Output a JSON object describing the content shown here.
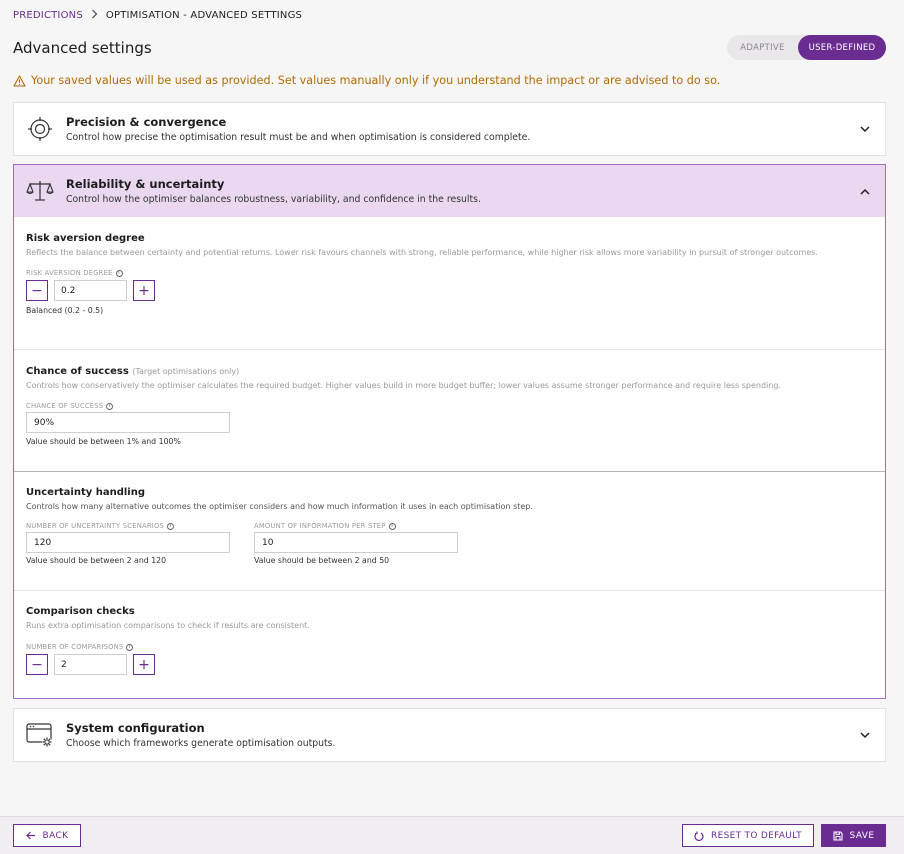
{
  "breadcrumb": {
    "link": "PREDICTIONS",
    "current": "OPTIMISATION - ADVANCED SETTINGS"
  },
  "page_title": "Advanced settings",
  "mode_toggle": {
    "options": [
      "ADAPTIVE",
      "USER-DEFINED"
    ],
    "selected": "USER-DEFINED"
  },
  "warning": "Your saved values will be used as provided. Set values manually only if you understand the impact or are advised to do so.",
  "panels": {
    "precision": {
      "title": "Precision & convergence",
      "desc": "Control how precise the optimisation result must be and when optimisation is considered complete.",
      "expanded": false
    },
    "reliability": {
      "title": "Reliability & uncertainty",
      "desc": "Control how the optimiser balances robustness, variability, and confidence in the results.",
      "expanded": true,
      "sections": {
        "risk": {
          "title": "Risk aversion degree",
          "desc": "Reflects the balance between certainty and potential returns. Lower risk favours channels with strong, reliable performance, while higher risk allows more variability in pursuit of stronger outcomes.",
          "label": "RISK AVERSION DEGREE",
          "value": "0.2",
          "hint": "Balanced (0.2 - 0.5)"
        },
        "chance": {
          "title": "Chance of success",
          "note": "(Target optimisations only)",
          "desc": "Controls how conservatively the optimiser calculates the required budget. Higher values build in more budget buffer; lower values assume stronger performance and require less spending.",
          "label": "CHANCE OF SUCCESS",
          "value": "90%",
          "hint": "Value should be between 1% and 100%"
        },
        "uncertainty": {
          "title": "Uncertainty handling",
          "desc": "Controls how many alternative outcomes the optimiser considers and how much information it uses in each optimisation step.",
          "scenarios_label": "NUMBER OF UNCERTAINTY SCENARIOS",
          "scenarios_value": "120",
          "scenarios_hint": "Value should be between 2 and 120",
          "info_label": "AMOUNT OF INFORMATION PER STEP",
          "info_value": "10",
          "info_hint": "Value should be between 2 and 50"
        },
        "comparison": {
          "title": "Comparison checks",
          "desc": "Runs extra optimisation comparisons to check if results are consistent.",
          "label": "NUMBER OF COMPARISONS",
          "value": "2"
        }
      }
    },
    "system": {
      "title": "System configuration",
      "desc": "Choose which frameworks generate optimisation outputs.",
      "expanded": false
    }
  },
  "footer": {
    "back": "BACK",
    "reset": "RESET TO DEFAULT",
    "save": "SAVE"
  },
  "colors": {
    "accent": "#6a2c91",
    "warning": "#b36b00",
    "highlight": "#ead7f0"
  }
}
